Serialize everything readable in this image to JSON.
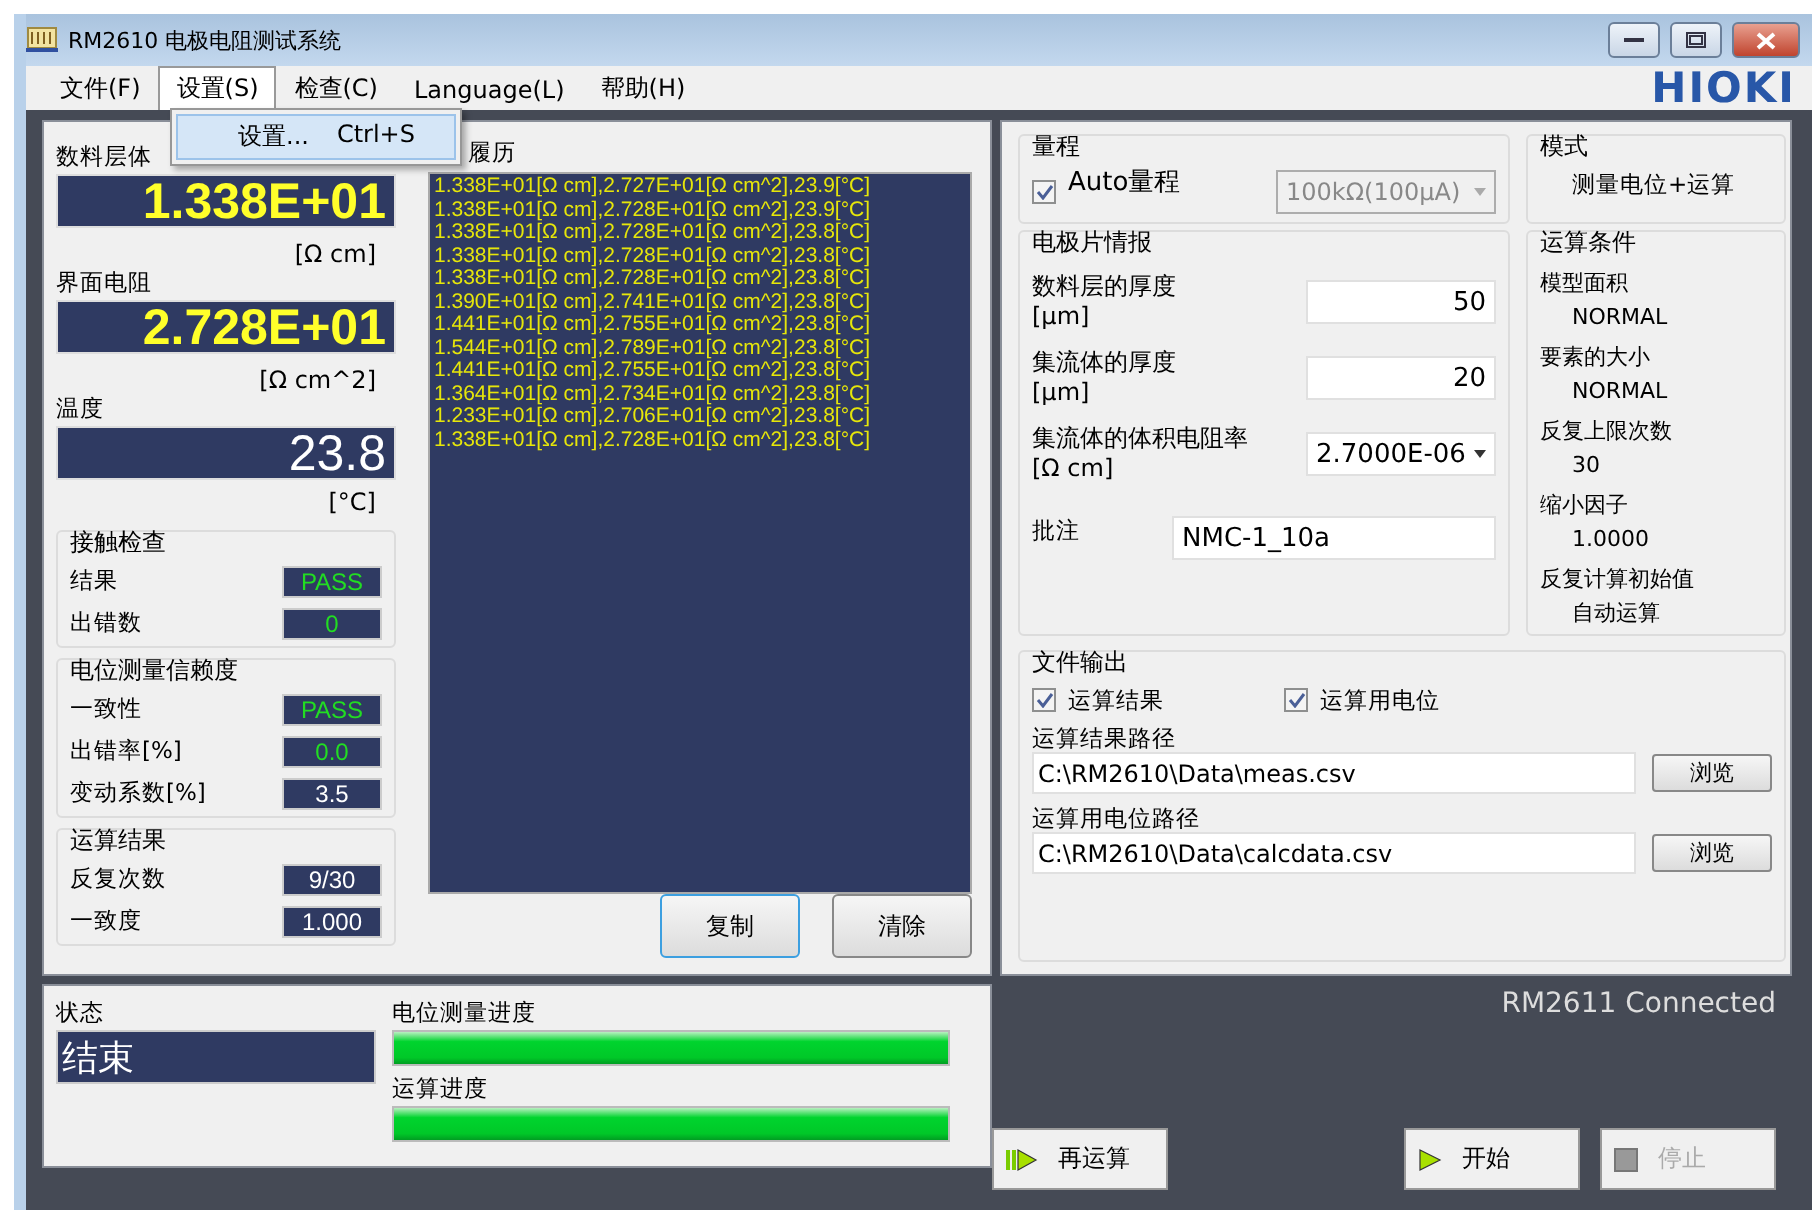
{
  "window": {
    "title": "RM2610 电极电阻测试系统",
    "logo": "HIOKI"
  },
  "menu": [
    {
      "label": "文件(F)",
      "selected": false
    },
    {
      "label": "设置(S)",
      "selected": true
    },
    {
      "label": "检查(C)",
      "selected": false
    },
    {
      "label": "Language(L)",
      "selected": false
    },
    {
      "label": "帮助(H)",
      "selected": false
    }
  ],
  "dropdown": [
    {
      "label": "设置...",
      "shortcut": "Ctrl+S"
    }
  ],
  "readouts": [
    {
      "label": "数料层体",
      "value": "1.338E+01",
      "unit": "[Ω cm]"
    },
    {
      "label": "界面电阻",
      "value": "2.728E+01",
      "unit": "[Ω cm^2]"
    },
    {
      "label": "温度",
      "value": "23.8",
      "unit": "[°C]"
    }
  ],
  "groups": [
    {
      "title": "接触检查",
      "rows": [
        {
          "label": "结果",
          "value": "PASS",
          "kind": "judgement"
        },
        {
          "label": "出错数",
          "value": "0",
          "kind": "judgement"
        }
      ]
    },
    {
      "title": "电位测量信赖度",
      "rows": [
        {
          "label": "一致性",
          "value": "PASS",
          "kind": "judgement"
        },
        {
          "label": "出错率[%]",
          "value": "0.0",
          "kind": "judgement"
        },
        {
          "label": "变动系数[%]",
          "value": "3.5",
          "kind": "reading"
        }
      ]
    },
    {
      "title": "运算结果",
      "rows": [
        {
          "label": "反复次数",
          "value": "9/30",
          "kind": "reading"
        },
        {
          "label": "一致度",
          "value": "1.000",
          "kind": "reading"
        }
      ]
    }
  ],
  "history": {
    "title": "履历",
    "lines": [
      "1.338E+01[Ω cm],2.727E+01[Ω cm^2],23.9[°C]",
      "1.338E+01[Ω cm],2.728E+01[Ω cm^2],23.9[°C]",
      "1.338E+01[Ω cm],2.728E+01[Ω cm^2],23.8[°C]",
      "1.338E+01[Ω cm],2.728E+01[Ω cm^2],23.8[°C]",
      "1.338E+01[Ω cm],2.728E+01[Ω cm^2],23.8[°C]",
      "1.390E+01[Ω cm],2.741E+01[Ω cm^2],23.8[°C]",
      "1.441E+01[Ω cm],2.755E+01[Ω cm^2],23.8[°C]",
      "1.544E+01[Ω cm],2.789E+01[Ω cm^2],23.8[°C]",
      "1.441E+01[Ω cm],2.755E+01[Ω cm^2],23.8[°C]",
      "1.364E+01[Ω cm],2.734E+01[Ω cm^2],23.8[°C]",
      "1.233E+01[Ω cm],2.706E+01[Ω cm^2],23.8[°C]",
      "1.338E+01[Ω cm],2.728E+01[Ω cm^2],23.8[°C]"
    ],
    "buttons": [
      "复制",
      "清除"
    ]
  },
  "status": {
    "label": "状态",
    "value": "结束",
    "progress": [
      {
        "label": "电位测量进度",
        "level": 1
      },
      {
        "label": "运算进度",
        "level": 1
      }
    ]
  },
  "range": {
    "title": "量程",
    "auto_label": "Auto量程",
    "auto_checked": true,
    "select": "100kΩ(100μA)"
  },
  "mode": {
    "title": "模式",
    "value": "测量电位+运算"
  },
  "electrode": {
    "title": "电极片情报",
    "fields": [
      {
        "kind": "input",
        "label": "数料层的厚度",
        "unit": "[μm]",
        "value": "50"
      },
      {
        "kind": "input",
        "label": "集流体的厚度",
        "unit": "[μm]",
        "value": "20"
      },
      {
        "kind": "select",
        "label": "集流体的体积电阻率",
        "unit": "[Ω cm]",
        "value": "2.7000E-06"
      }
    ],
    "note_label": "批注",
    "note": "NMC-1_10a"
  },
  "conditions": {
    "title": "运算条件",
    "items": [
      {
        "label": "模型面积",
        "value": "NORMAL"
      },
      {
        "label": "要素的大小",
        "value": "NORMAL"
      },
      {
        "label": "反复上限次数",
        "value": "30"
      },
      {
        "label": "缩小因子",
        "value": "1.0000"
      },
      {
        "label": "反复计算初始值",
        "value": "自动运算"
      }
    ]
  },
  "file_output": {
    "title": "文件输出",
    "checks": [
      {
        "label": "运算结果",
        "checked": true
      },
      {
        "label": "运算用电位",
        "checked": true
      }
    ],
    "paths": [
      {
        "label": "运算结果路径",
        "value": "C:\\RM2610\\Data\\meas.csv",
        "button": "浏览"
      },
      {
        "label": "运算用电位路径",
        "value": "C:\\RM2610\\Data\\calcdata.csv",
        "button": "浏览"
      }
    ]
  },
  "connection": "RM2611 Connected",
  "actions": [
    {
      "kind": "recalc",
      "label": "再运算",
      "disabled": false
    },
    {
      "kind": "start",
      "label": "开始",
      "disabled": false
    },
    {
      "kind": "stop",
      "label": "停止",
      "disabled": true
    }
  ]
}
